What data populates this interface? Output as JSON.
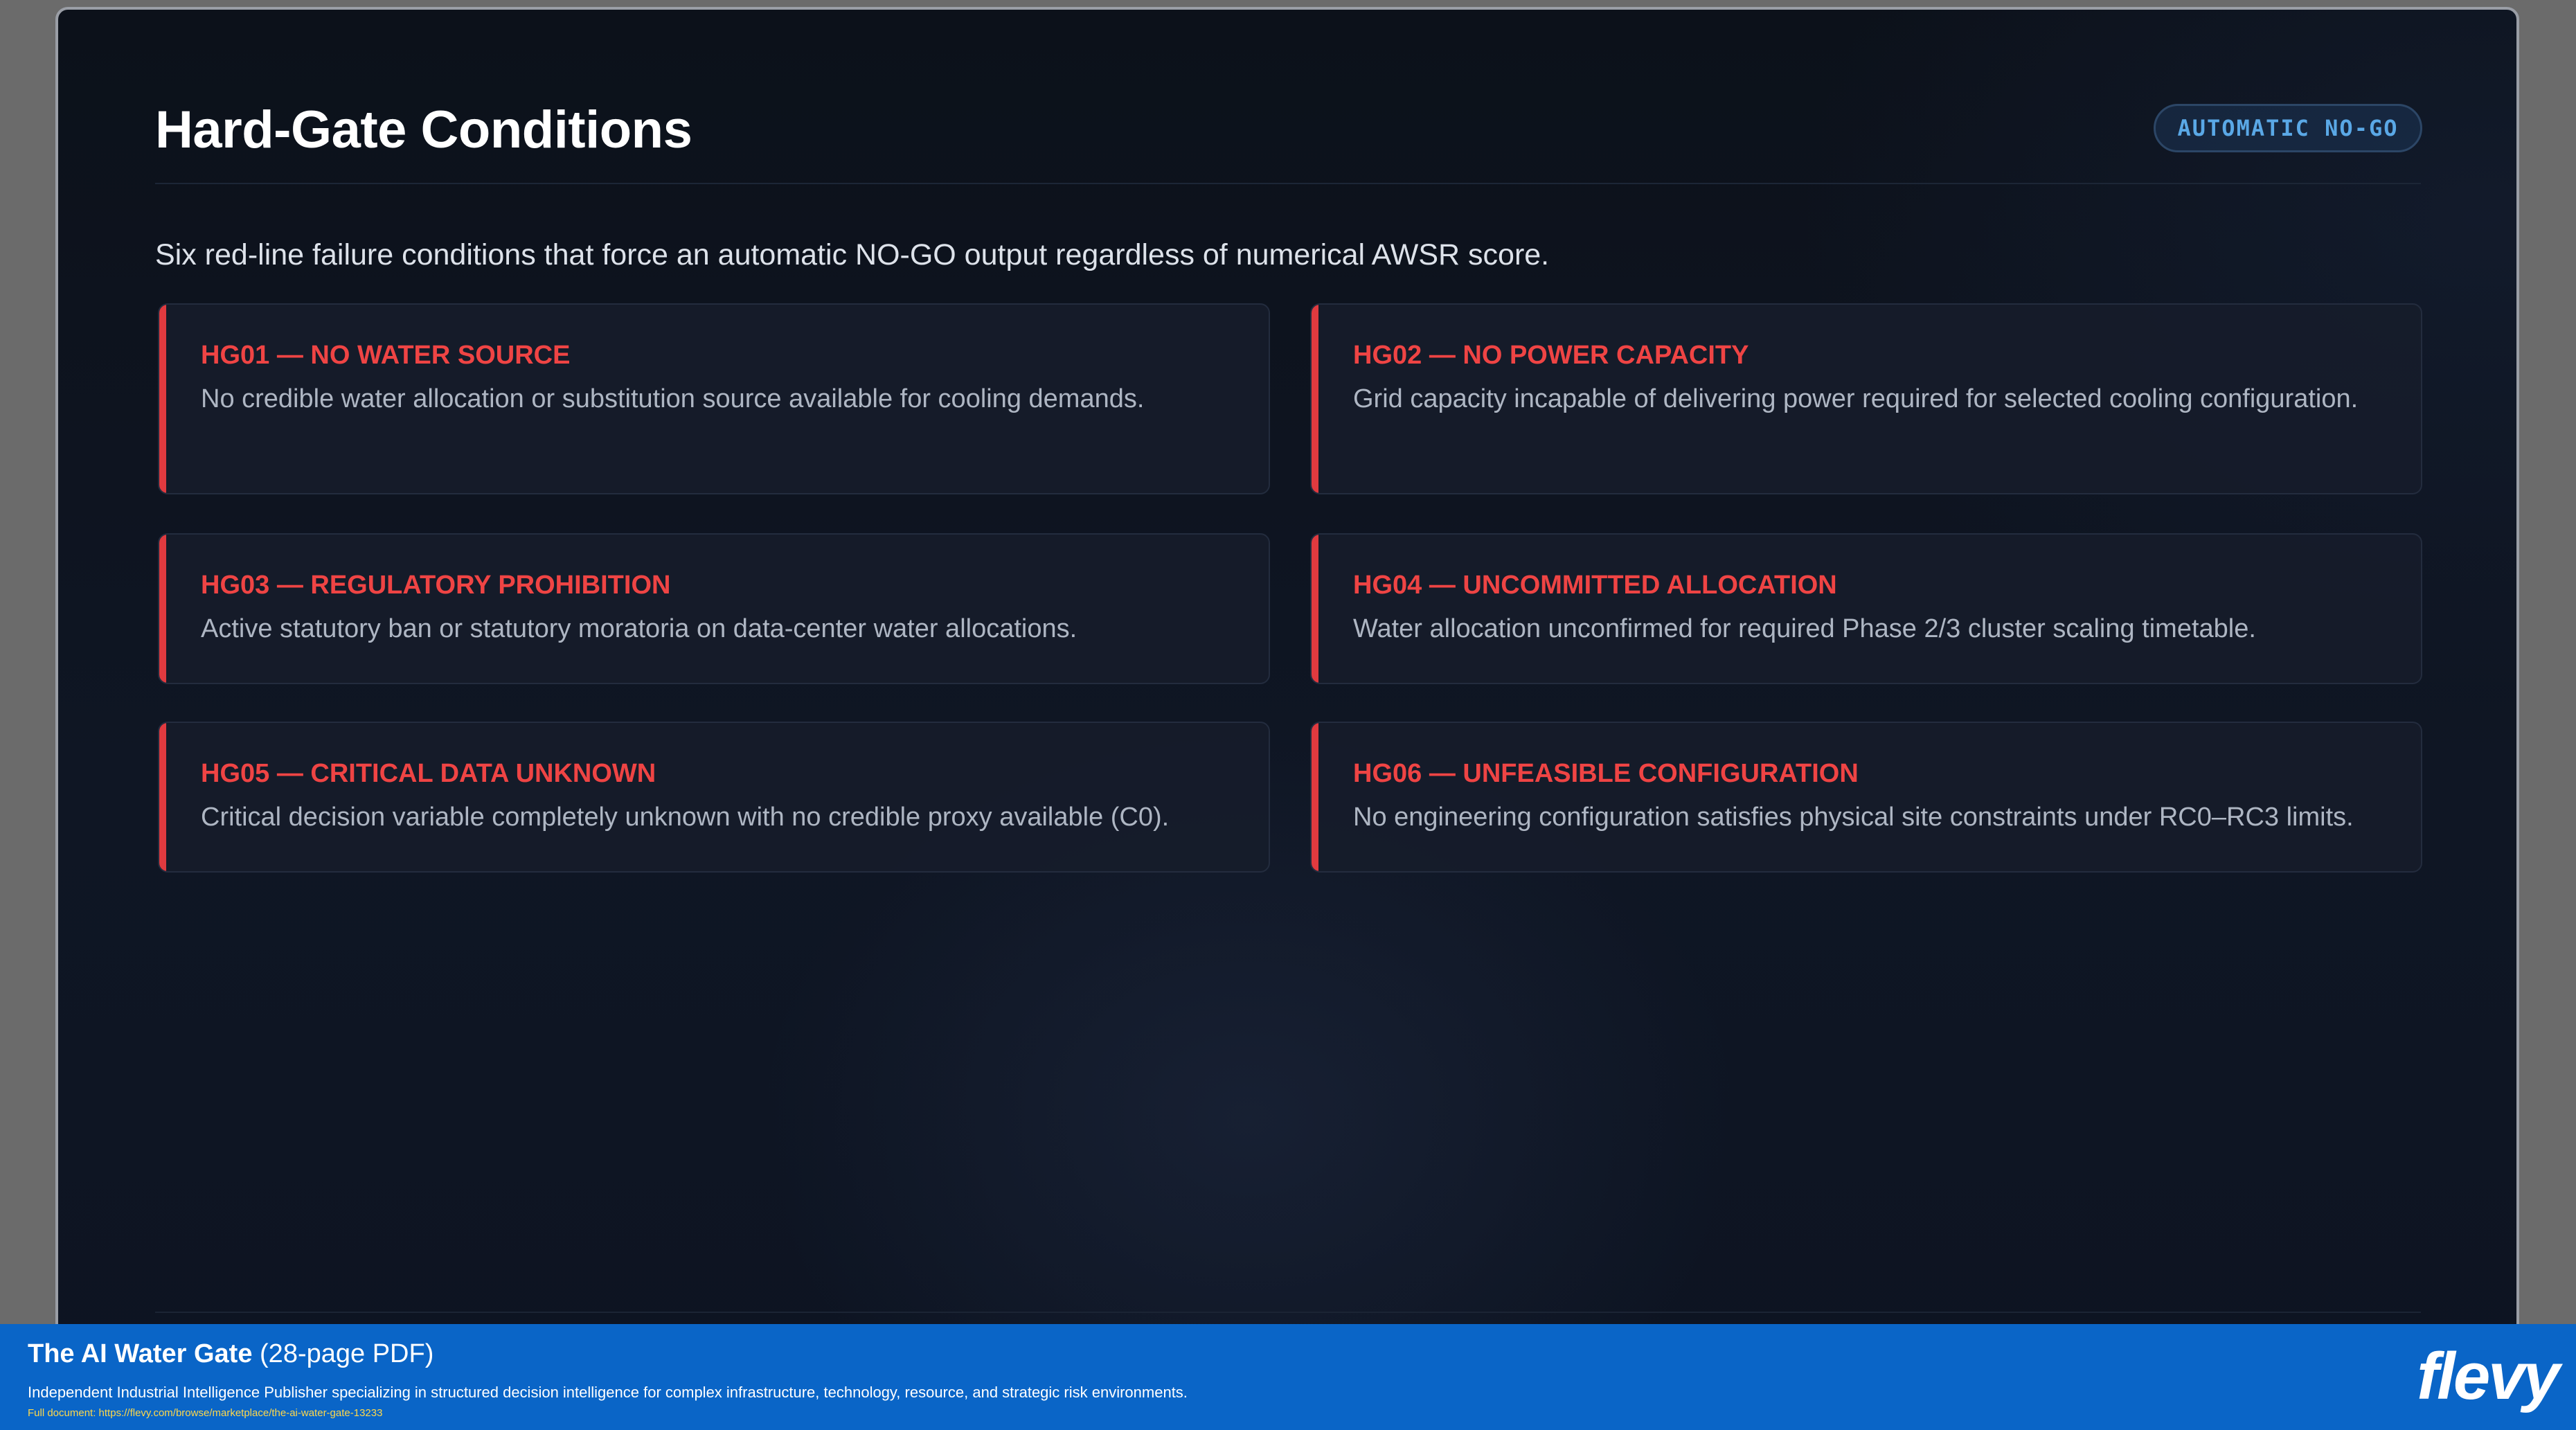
{
  "slide": {
    "title": "Hard-Gate Conditions",
    "badge": "AUTOMATIC NO-GO",
    "subtitle": "Six red-line failure conditions that force an automatic NO-GO output regardless of numerical AWSR score.",
    "accent_color": "#ef4444",
    "badge_color": "#5aa8e6",
    "conditions": [
      {
        "title": "HG01 — NO WATER SOURCE",
        "description": "No credible water allocation or substitution source available for cooling demands."
      },
      {
        "title": "HG02 — NO POWER CAPACITY",
        "description": "Grid capacity incapable of delivering power required for selected cooling configuration."
      },
      {
        "title": "HG03 — REGULATORY PROHIBITION",
        "description": "Active statutory ban or statutory moratoria on data-center water allocations."
      },
      {
        "title": "HG04 — UNCOMMITTED ALLOCATION",
        "description": "Water allocation unconfirmed for required Phase 2/3 cluster scaling timetable."
      },
      {
        "title": "HG05 — CRITICAL DATA UNKNOWN",
        "description": "Critical decision variable completely unknown with no credible proxy available (C0)."
      },
      {
        "title": "HG06 — UNFEASIBLE CONFIGURATION",
        "description": "No engineering configuration satisfies physical site constraints under RC0–RC3 limits."
      }
    ]
  },
  "footer": {
    "document_name": "The AI Water Gate",
    "page_count": "(28-page PDF)",
    "description": "Independent Industrial Intelligence Publisher specializing in structured decision intelligence for complex infrastructure, technology, resource, and strategic risk environments.",
    "full_document_url": "Full document: https://flevy.com/browse/marketplace/the-ai-water-gate-13233",
    "logo_text": "flevy",
    "background_color": "#0a65c7"
  }
}
